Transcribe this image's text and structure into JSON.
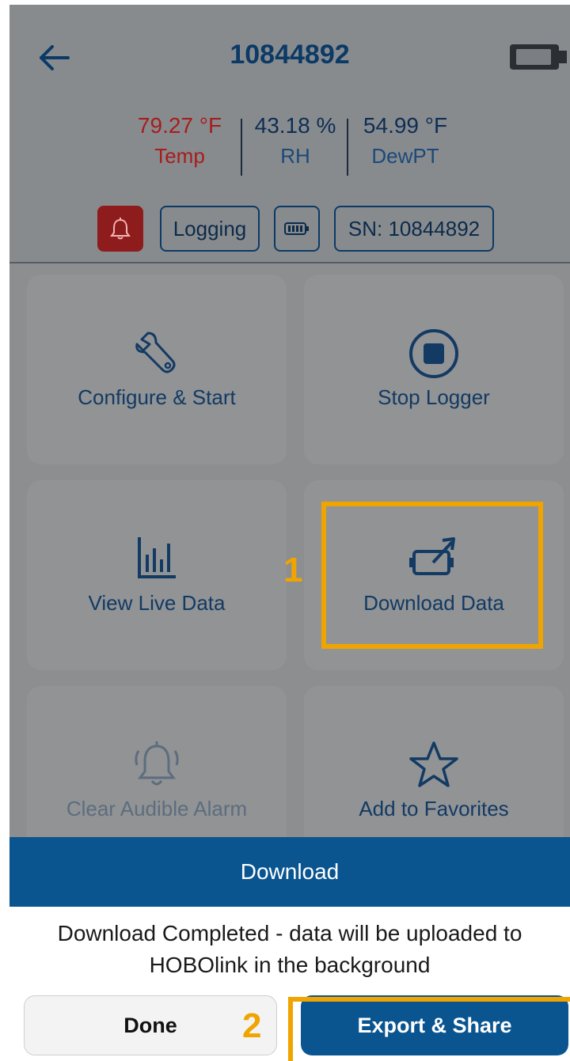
{
  "header": {
    "title": "10844892",
    "back_icon": "arrow-left-icon",
    "device_icon": "logger-device-icon"
  },
  "readings": [
    {
      "value": "79.27 °F",
      "label": "Temp",
      "color": "#a71d1d"
    },
    {
      "value": "43.18 %",
      "label": "RH"
    },
    {
      "value": "54.99 °F",
      "label": "DewPT"
    }
  ],
  "status_chips": {
    "alarm_icon": "bell-icon",
    "logging": "Logging",
    "battery_icon": "battery-icon",
    "serial": "SN: 10844892"
  },
  "actions": [
    {
      "label": "Configure & Start",
      "icon": "wrench-icon",
      "enabled": true
    },
    {
      "label": "Stop Logger",
      "icon": "stop-icon",
      "enabled": true
    },
    {
      "label": "View Live Data",
      "icon": "bar-chart-icon",
      "enabled": true
    },
    {
      "label": "Download Data",
      "icon": "download-device-icon",
      "enabled": true
    },
    {
      "label": "Clear Audible Alarm",
      "icon": "ringing-bell-icon",
      "enabled": false
    },
    {
      "label": "Add to Favorites",
      "icon": "star-icon",
      "enabled": true
    }
  ],
  "annotations": {
    "step1": "1",
    "step2": "2",
    "highlight_color": "#f0a400"
  },
  "dialog": {
    "title": "Download",
    "message": "Download Completed - data will be uploaded to HOBOlink in the background",
    "done_label": "Done",
    "export_label": "Export & Share"
  },
  "colors": {
    "primary": "#0a5590",
    "alarm": "#8e1c1c"
  }
}
